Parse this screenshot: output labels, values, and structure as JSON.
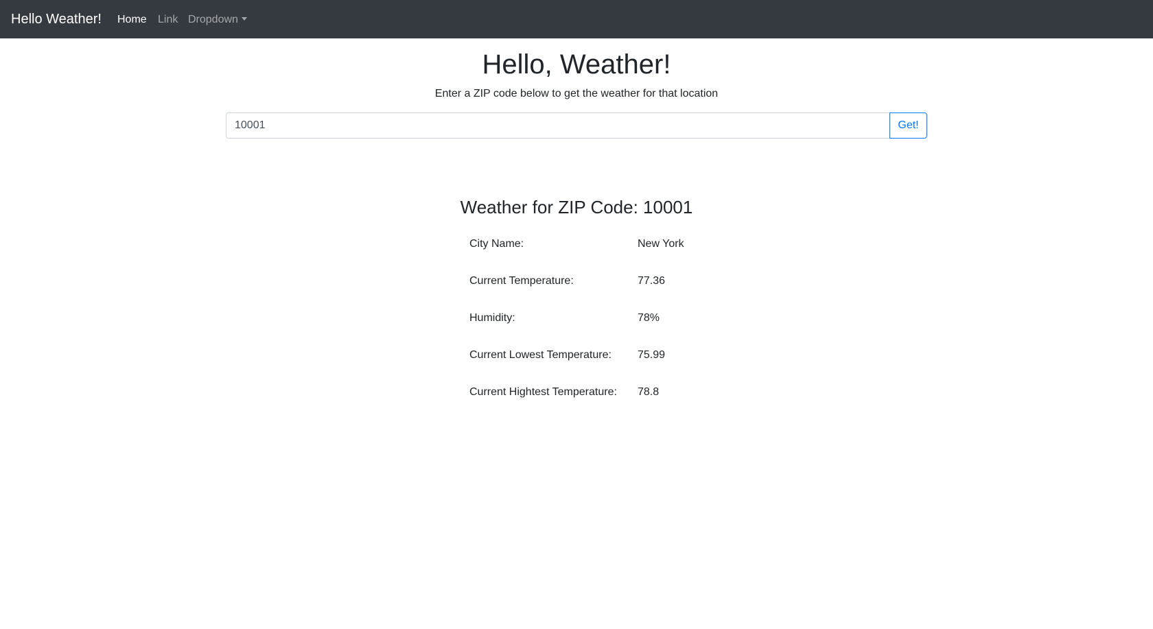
{
  "navbar": {
    "brand": "Hello Weather!",
    "items": [
      {
        "label": "Home",
        "active": true
      },
      {
        "label": "Link",
        "active": false
      },
      {
        "label": "Dropdown",
        "active": false
      }
    ],
    "background": "#343a40"
  },
  "hero": {
    "title": "Hello, Weather!",
    "subtitle": "Enter a ZIP code below to get the weather for that location"
  },
  "search": {
    "value": "10001",
    "button_label": "Get!"
  },
  "result": {
    "heading": "Weather for ZIP Code: 10001",
    "rows": [
      {
        "label": "City Name:",
        "value": "New York"
      },
      {
        "label": "Current Temperature:",
        "value": "77.36"
      },
      {
        "label": "Humidity:",
        "value": "78%"
      },
      {
        "label": "Current Lowest Temperature:",
        "value": "75.99"
      },
      {
        "label": "Current Hightest Temperature:",
        "value": "78.8"
      }
    ]
  },
  "colors": {
    "accent": "#007bff",
    "text": "#212529"
  },
  "icons": [
    "dropdown-caret-icon"
  ]
}
